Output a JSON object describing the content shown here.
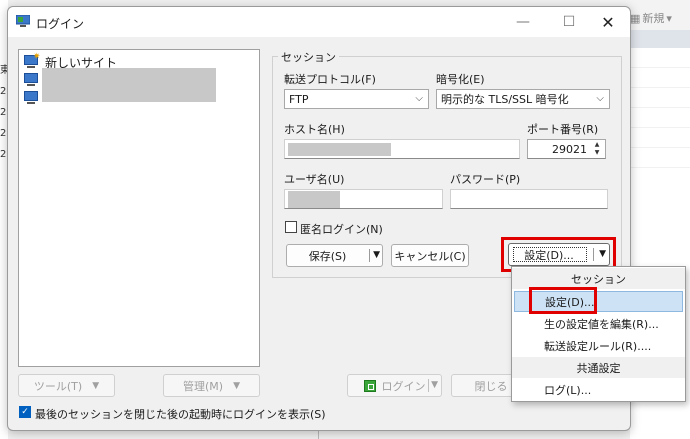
{
  "background": {
    "toolbar_new": "新規",
    "left_chars": [
      "東",
      "2",
      "2",
      "2",
      "2"
    ]
  },
  "dialog": {
    "title": "ログイン"
  },
  "sites": {
    "new_site": "新しいサイト"
  },
  "session": {
    "group_title": "セッション",
    "protocol_label": "転送プロトコル(F)",
    "protocol_value": "FTP",
    "encryption_label": "暗号化(E)",
    "encryption_value": "明示的な TLS/SSL 暗号化",
    "host_label": "ホスト名(H)",
    "port_label": "ポート番号(R)",
    "port_value": "29021",
    "user_label": "ユーザ名(U)",
    "password_label": "パスワード(P)",
    "anonymous_label": "匿名ログイン(N)",
    "save_label": "保存(S)",
    "cancel_label": "キャンセル(C)",
    "settings_label": "設定(D)..."
  },
  "bottom": {
    "tools_label": "ツール(T)",
    "manage_label": "管理(M)",
    "login_label": "ログイン",
    "close_label": "閉じる",
    "show_login_label": "最後のセッションを閉じた後の起動時にログインを表示(S)"
  },
  "menu": {
    "session_header": "セッション",
    "settings": "設定(D)...",
    "edit_raw": "生の設定値を編集(R)...",
    "transfer_rules": "転送設定ルール(R)....",
    "global_header": "共通設定",
    "log": "ログ(L)..."
  }
}
